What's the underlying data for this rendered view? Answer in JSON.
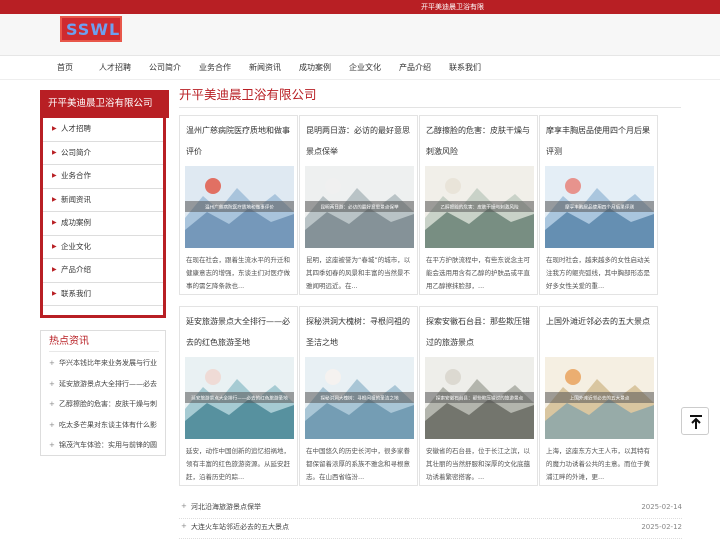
{
  "topbar": {
    "text": "开平美迪晨卫浴有限"
  },
  "logo": {
    "text": "SSWL"
  },
  "nav": [
    "首页",
    "人才招聘",
    "公司简介",
    "业务合作",
    "新闻资讯",
    "成功案例",
    "企业文化",
    "产品介绍",
    "联系我们"
  ],
  "sidebar": {
    "title": "开平美迪晨卫浴有限公司",
    "items": [
      "人才招聘",
      "公司简介",
      "业务合作",
      "新闻资讯",
      "成功案例",
      "企业文化",
      "产品介绍",
      "联系我们"
    ]
  },
  "hot": {
    "title": "热点资讯",
    "items": [
      "华兴本钱比年来业务发展与行业",
      "延安旅游景点大全排行——必去",
      "乙醇擦脸的危害：皮肤干燥与刺",
      "吃太多芒果对东谈主体有什么影",
      "锦茂汽车体验：实用与前锋的圆"
    ]
  },
  "main": {
    "title": "开平美迪晨卫浴有限公司",
    "cards": [
      {
        "title": "温州广慈病院医疗质地和做事评价",
        "caption": "温州广慈病院医疗质地和做事评价",
        "desc": "在现在社会，跟着生流水平的升迁和健康意志的增强，东谈主们对医疗做事的需乞降条款也..."
      },
      {
        "title": "昆明两日游：必访的最好意思景点保举",
        "caption": "昆明两日游：必访的最好意思景点保举",
        "desc": "昆明，这座被誉为“春城”的城市，以其四季如春的风景和丰富的当然景不雅闻明远近。在..."
      },
      {
        "title": "乙醇擦脸的危害：皮肤干燥与刺激风险",
        "caption": "乙醇擦脸的危害：皮肤干燥与刺激风险",
        "desc": "在平方护肤流程中，有些东说念主可能会选用用含有乙醇的护肤品或平直用乙醇擦抹脸部，..."
      },
      {
        "title": "摩享丰胸居品使用四个月后果评测",
        "caption": "摩享丰胸居品使用四个月后果评测",
        "desc": "在现时社会，越来越多的女性启动关注我方的躯壳弧线，其中胸部形态是好多女性关爱的重..."
      },
      {
        "title": "延安旅游景点大全排行——必去的红色旅游圣地",
        "caption": "延安旅游景点大全排行——必去的红色旅游圣地",
        "desc": "延安，动作中国创新的追忆招祸地，领有丰富的红色旅游资源。从延安赶赶，沿着历史的踪..."
      },
      {
        "title": "探秘洪洞大槐树：寻根问祖的圣洁之地",
        "caption": "探秘洪洞大槐树：寻根问祖的圣洁之地",
        "desc": "在中国悠久的历史长河中，很多家眷都保留着浓厚的系族不雅念和寻根意志。在山西省临汾..."
      },
      {
        "title": "探索安徽石台县：那些欺压错过的旅游景点",
        "caption": "探索安徽石台县：那些欺压错过的旅游景点",
        "desc": "安徽省的石台县，位于长江之滨，以其壮丽的当然舒服和深厚的文化底蕴功诱着繁密搭客。..."
      },
      {
        "title": "上国外滩近邻必去的五大景点",
        "caption": "上国外滩近邻必去的五大景点",
        "desc": "上海，这座东方大王人市，以其特有的魔力功诱着公共的主意。而位于黄浦江畔的外滩，更..."
      }
    ],
    "news": [
      {
        "text": "河北沿海旅游景点保举",
        "date": "2025-02-14"
      },
      {
        "text": "大连火车站邻近必去的五大景点",
        "date": "2025-02-12"
      }
    ]
  },
  "colors": {
    "accent": "#b81f24"
  },
  "icons": {
    "back_to_top": "arrow-up-to-line-icon"
  }
}
